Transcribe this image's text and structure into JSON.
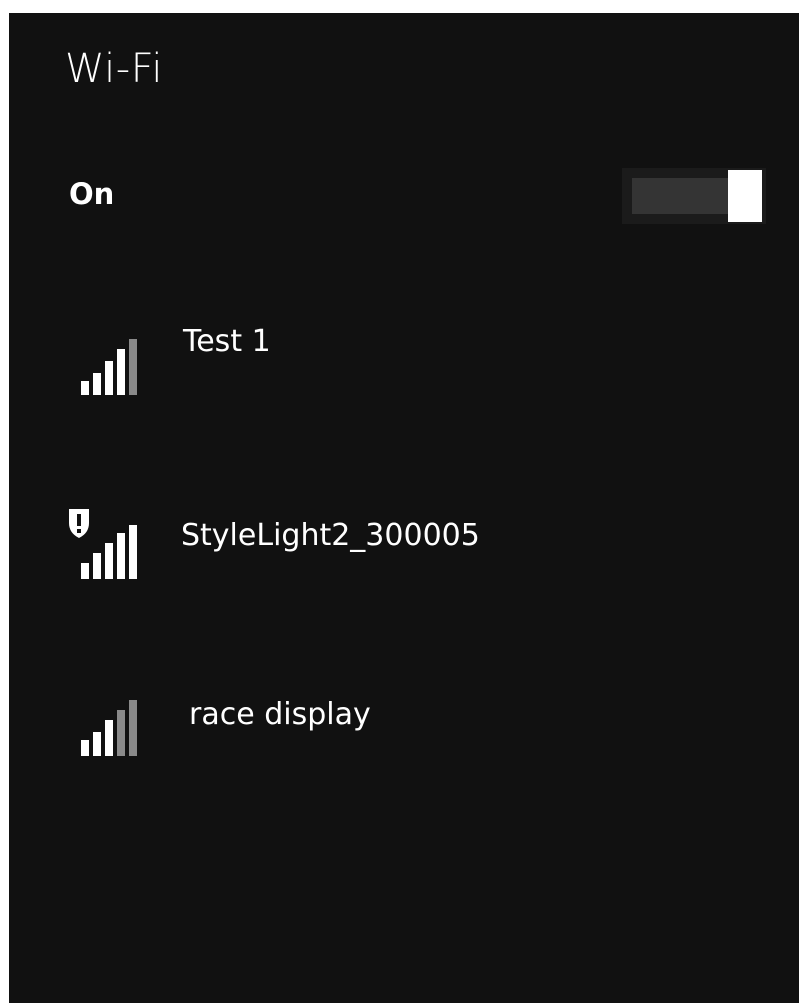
{
  "wifi": {
    "title": "Wi-Fi",
    "state_label": "On",
    "toggle_on": true
  },
  "networks": [
    {
      "name": "Test 1",
      "signal_bars": 4,
      "max_bars": 5,
      "secured_warning": false
    },
    {
      "name": "StyleLight2_300005",
      "signal_bars": 5,
      "max_bars": 5,
      "secured_warning": true
    },
    {
      "name": "race display",
      "signal_bars": 3,
      "max_bars": 5,
      "secured_warning": false
    }
  ],
  "colors": {
    "background": "#111111",
    "text": "#ffffff",
    "bar_active": "#ffffff",
    "bar_inactive": "#8a8a8a",
    "toggle_track": "#343434",
    "toggle_thumb": "#ffffff"
  }
}
